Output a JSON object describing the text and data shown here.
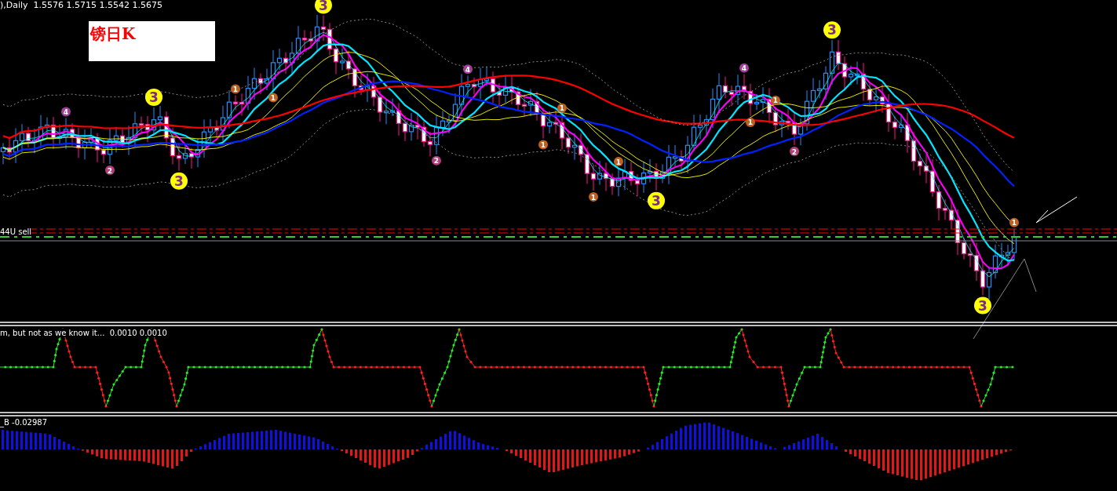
{
  "chart_header": "),Daily  1.5576 1.5715 1.5542 1.5675",
  "title_box": {
    "text": "镑日K"
  },
  "order_line": {
    "label": "44U sell"
  },
  "markers": [
    {
      "label": "4",
      "color": "#a0409a"
    },
    {
      "label": "2",
      "color": "#b0407a"
    },
    {
      "label": "3",
      "color": "#ffff00"
    },
    {
      "label": "3",
      "color": "#ffff00"
    },
    {
      "label": "1",
      "color": "#c06020"
    },
    {
      "label": "1",
      "color": "#c06020"
    },
    {
      "label": "3",
      "color": "#ffff00"
    },
    {
      "label": "2",
      "color": "#b0407a"
    },
    {
      "label": "4",
      "color": "#a0409a"
    },
    {
      "label": "1",
      "color": "#c06020"
    },
    {
      "label": "1",
      "color": "#c06020"
    },
    {
      "label": "1",
      "color": "#c06020"
    },
    {
      "label": "1",
      "color": "#c06020"
    },
    {
      "label": "3",
      "color": "#ffff00"
    },
    {
      "label": "4",
      "color": "#a0409a"
    },
    {
      "label": "1",
      "color": "#c06020"
    },
    {
      "label": "1",
      "color": "#c06020"
    },
    {
      "label": "2",
      "color": "#b0407a"
    },
    {
      "label": "3",
      "color": "#ffff00"
    },
    {
      "label": "3",
      "color": "#ffff00"
    },
    {
      "label": "1",
      "color": "#c06020"
    }
  ],
  "oscillator": {
    "label": "m, but not as we know it...  0.0010 0.0010"
  },
  "histogram": {
    "label": "_B -0.02987"
  }
}
